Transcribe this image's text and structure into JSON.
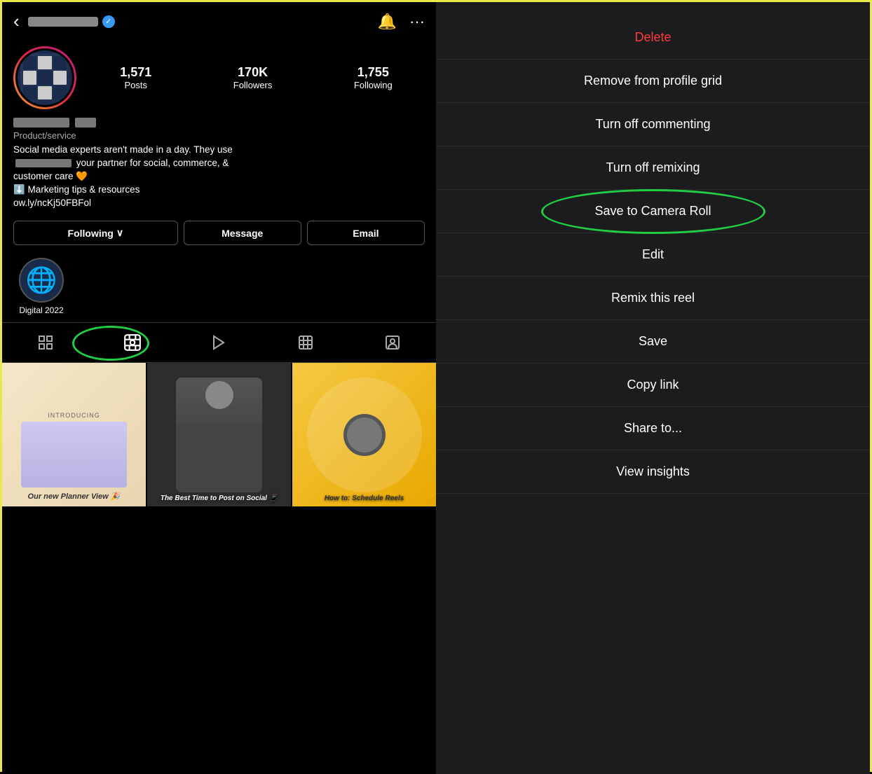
{
  "header": {
    "back_icon": "‹",
    "notifications_icon": "🔔",
    "more_icon": "···"
  },
  "profile": {
    "stats": {
      "posts_count": "1,571",
      "posts_label": "Posts",
      "followers_count": "170K",
      "followers_label": "Followers",
      "following_count": "1,755",
      "following_label": "Following"
    },
    "category": "Product/service",
    "bio_line1": "Social media experts aren't made in a day. They use",
    "bio_line2": "your partner for social, commerce, &",
    "bio_line3": "customer care 🧡",
    "bio_line4": "⬇️ Marketing tips & resources",
    "bio_link": "ow.ly/ncKj50FBFol"
  },
  "buttons": {
    "following": "Following",
    "following_arrow": "∨",
    "message": "Message",
    "email": "Email"
  },
  "highlights": {
    "label": "Digital 2022"
  },
  "tabs": {
    "grid": "⊞",
    "reels": "▶",
    "video": "▷",
    "tagged": "🔖",
    "mentions": "👤"
  },
  "grid_items": [
    {
      "introducing": "INTRODUCING",
      "caption": "Our new Planner View 🎉"
    },
    {
      "caption": "The Best Time to Post on Social 📱"
    },
    {
      "caption": "How to: Schedule Reels"
    }
  ],
  "right_menu": {
    "delete": "Delete",
    "remove_from_grid": "Remove from profile grid",
    "turn_off_commenting": "Turn off commenting",
    "turn_off_remixing": "Turn off remixing",
    "save_to_camera_roll": "Save to Camera Roll",
    "edit": "Edit",
    "remix_this_reel": "Remix this reel",
    "save": "Save",
    "copy_link": "Copy link",
    "share_to": "Share to...",
    "view_insights": "View insights"
  }
}
